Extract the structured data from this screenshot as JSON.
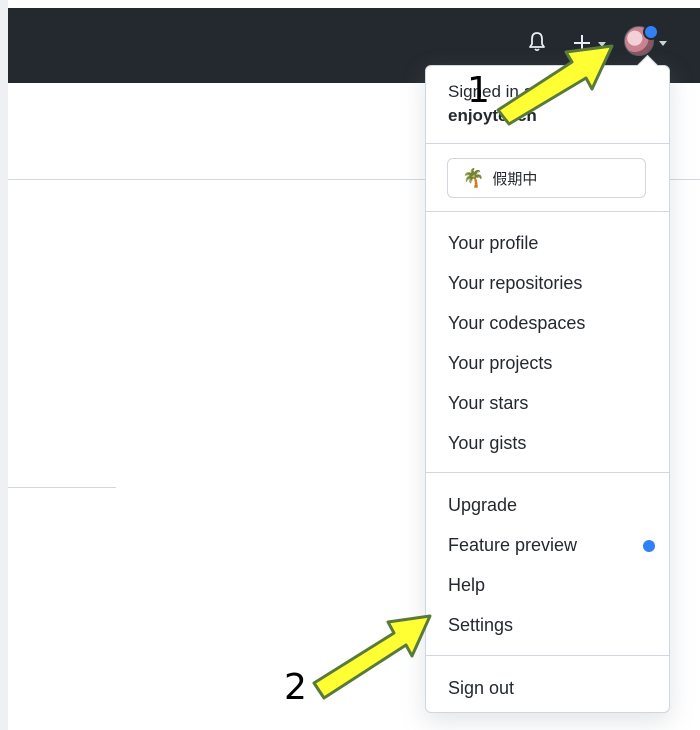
{
  "header": {
    "icons": [
      "bell-icon",
      "plus-icon",
      "avatar"
    ],
    "accent_dot_color": "#2f81f7"
  },
  "menu": {
    "signed_in_prefix": "Signed in as",
    "username": "enjoyteach",
    "status": {
      "emoji": "🌴",
      "text": "假期中"
    },
    "profile_items": [
      "Your profile",
      "Your repositories",
      "Your codespaces",
      "Your projects",
      "Your stars",
      "Your gists"
    ],
    "account_items": [
      "Upgrade",
      "Feature preview",
      "Help",
      "Settings"
    ],
    "sign_out": "Sign out"
  },
  "annotations": {
    "step1": "1",
    "step2": "2"
  }
}
